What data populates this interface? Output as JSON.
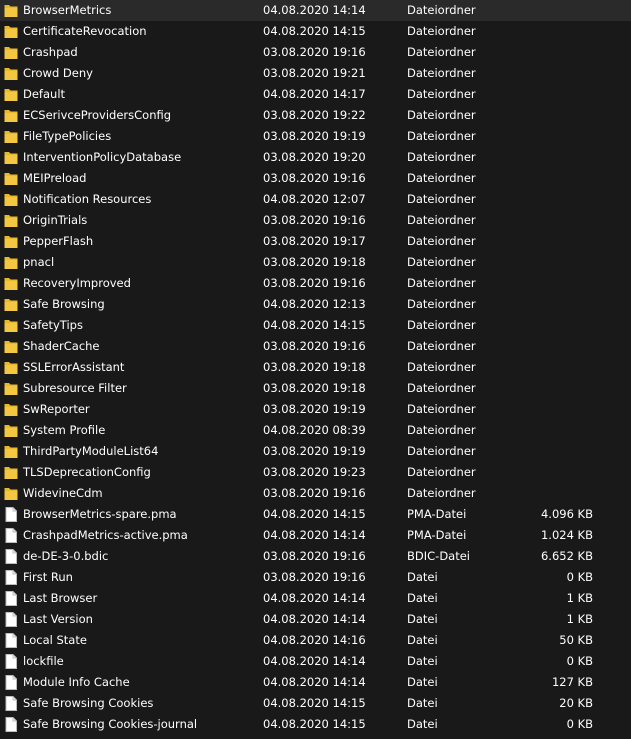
{
  "colors": {
    "background": "#191919",
    "text": "#ffffff",
    "folder": "#e8b929",
    "file": "#ffffff"
  },
  "files": [
    {
      "name": "BrowserMetrics",
      "date": "04.08.2020 14:14",
      "type": "Dateiordner",
      "size": "",
      "icon": "folder-icon"
    },
    {
      "name": "CertificateRevocation",
      "date": "04.08.2020 14:15",
      "type": "Dateiordner",
      "size": "",
      "icon": "folder-icon"
    },
    {
      "name": "Crashpad",
      "date": "03.08.2020 19:16",
      "type": "Dateiordner",
      "size": "",
      "icon": "folder-icon"
    },
    {
      "name": "Crowd Deny",
      "date": "03.08.2020 19:21",
      "type": "Dateiordner",
      "size": "",
      "icon": "folder-icon"
    },
    {
      "name": "Default",
      "date": "04.08.2020 14:17",
      "type": "Dateiordner",
      "size": "",
      "icon": "folder-icon"
    },
    {
      "name": "ECSerivceProvidersConfig",
      "date": "03.08.2020 19:22",
      "type": "Dateiordner",
      "size": "",
      "icon": "folder-icon"
    },
    {
      "name": "FileTypePolicies",
      "date": "03.08.2020 19:19",
      "type": "Dateiordner",
      "size": "",
      "icon": "folder-icon"
    },
    {
      "name": "InterventionPolicyDatabase",
      "date": "03.08.2020 19:20",
      "type": "Dateiordner",
      "size": "",
      "icon": "folder-icon"
    },
    {
      "name": "MEIPreload",
      "date": "03.08.2020 19:16",
      "type": "Dateiordner",
      "size": "",
      "icon": "folder-icon"
    },
    {
      "name": "Notification Resources",
      "date": "04.08.2020 12:07",
      "type": "Dateiordner",
      "size": "",
      "icon": "folder-icon"
    },
    {
      "name": "OriginTrials",
      "date": "03.08.2020 19:16",
      "type": "Dateiordner",
      "size": "",
      "icon": "folder-icon"
    },
    {
      "name": "PepperFlash",
      "date": "03.08.2020 19:17",
      "type": "Dateiordner",
      "size": "",
      "icon": "folder-icon"
    },
    {
      "name": "pnacl",
      "date": "03.08.2020 19:18",
      "type": "Dateiordner",
      "size": "",
      "icon": "folder-icon"
    },
    {
      "name": "RecoveryImproved",
      "date": "03.08.2020 19:16",
      "type": "Dateiordner",
      "size": "",
      "icon": "folder-icon"
    },
    {
      "name": "Safe Browsing",
      "date": "04.08.2020 12:13",
      "type": "Dateiordner",
      "size": "",
      "icon": "folder-icon"
    },
    {
      "name": "SafetyTips",
      "date": "04.08.2020 14:15",
      "type": "Dateiordner",
      "size": "",
      "icon": "folder-icon"
    },
    {
      "name": "ShaderCache",
      "date": "03.08.2020 19:16",
      "type": "Dateiordner",
      "size": "",
      "icon": "folder-icon"
    },
    {
      "name": "SSLErrorAssistant",
      "date": "03.08.2020 19:18",
      "type": "Dateiordner",
      "size": "",
      "icon": "folder-icon"
    },
    {
      "name": "Subresource Filter",
      "date": "03.08.2020 19:18",
      "type": "Dateiordner",
      "size": "",
      "icon": "folder-icon"
    },
    {
      "name": "SwReporter",
      "date": "03.08.2020 19:19",
      "type": "Dateiordner",
      "size": "",
      "icon": "folder-icon"
    },
    {
      "name": "System Profile",
      "date": "04.08.2020 08:39",
      "type": "Dateiordner",
      "size": "",
      "icon": "folder-icon"
    },
    {
      "name": "ThirdPartyModuleList64",
      "date": "03.08.2020 19:19",
      "type": "Dateiordner",
      "size": "",
      "icon": "folder-icon"
    },
    {
      "name": "TLSDeprecationConfig",
      "date": "03.08.2020 19:23",
      "type": "Dateiordner",
      "size": "",
      "icon": "folder-icon"
    },
    {
      "name": "WidevineCdm",
      "date": "03.08.2020 19:16",
      "type": "Dateiordner",
      "size": "",
      "icon": "folder-icon"
    },
    {
      "name": "BrowserMetrics-spare.pma",
      "date": "04.08.2020 14:15",
      "type": "PMA-Datei",
      "size": "4.096 KB",
      "icon": "file-icon"
    },
    {
      "name": "CrashpadMetrics-active.pma",
      "date": "04.08.2020 14:14",
      "type": "PMA-Datei",
      "size": "1.024 KB",
      "icon": "file-icon"
    },
    {
      "name": "de-DE-3-0.bdic",
      "date": "03.08.2020 19:16",
      "type": "BDIC-Datei",
      "size": "6.652 KB",
      "icon": "file-icon"
    },
    {
      "name": "First Run",
      "date": "03.08.2020 19:16",
      "type": "Datei",
      "size": "0 KB",
      "icon": "file-icon"
    },
    {
      "name": "Last Browser",
      "date": "04.08.2020 14:14",
      "type": "Datei",
      "size": "1 KB",
      "icon": "file-icon"
    },
    {
      "name": "Last Version",
      "date": "04.08.2020 14:14",
      "type": "Datei",
      "size": "1 KB",
      "icon": "file-icon"
    },
    {
      "name": "Local State",
      "date": "04.08.2020 14:16",
      "type": "Datei",
      "size": "50 KB",
      "icon": "file-icon"
    },
    {
      "name": "lockfile",
      "date": "04.08.2020 14:14",
      "type": "Datei",
      "size": "0 KB",
      "icon": "file-icon"
    },
    {
      "name": "Module Info Cache",
      "date": "04.08.2020 14:14",
      "type": "Datei",
      "size": "127 KB",
      "icon": "file-icon"
    },
    {
      "name": "Safe Browsing Cookies",
      "date": "04.08.2020 14:15",
      "type": "Datei",
      "size": "20 KB",
      "icon": "file-icon"
    },
    {
      "name": "Safe Browsing Cookies-journal",
      "date": "04.08.2020 14:15",
      "type": "Datei",
      "size": "0 KB",
      "icon": "file-icon"
    }
  ]
}
